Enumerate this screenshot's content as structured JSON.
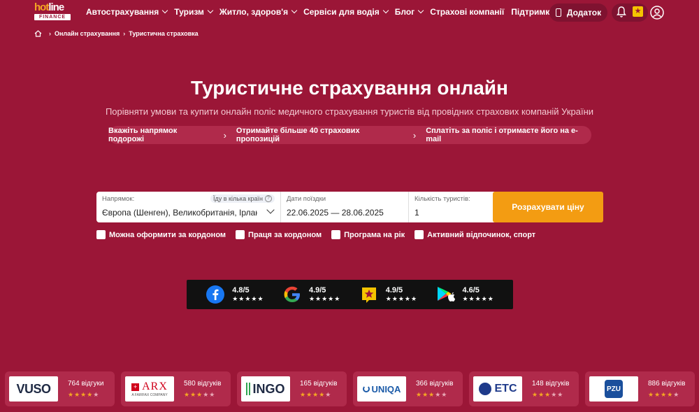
{
  "header": {
    "logo_top": "hotline",
    "logo_hot": "hot",
    "logo_line": "line",
    "logo_bottom": "FINANCE",
    "nav": [
      {
        "label": "Автострахування",
        "dropdown": true
      },
      {
        "label": "Туризм",
        "dropdown": true
      },
      {
        "label": "Житло, здоров'я",
        "dropdown": true
      },
      {
        "label": "Сервіси для водія",
        "dropdown": true
      },
      {
        "label": "Блог",
        "dropdown": true
      },
      {
        "label": "Страхові компанії",
        "dropdown": false
      },
      {
        "label": "Підтримка",
        "dropdown": false
      }
    ],
    "app_button": "Додаток"
  },
  "breadcrumb": [
    "Онлайн страхування",
    "Туристична страховка"
  ],
  "hero": {
    "title": "Туристичне страхування онлайн",
    "subtitle": "Порівняти умови та купити онлайн поліс медичного страхування туристів від провідних страхових компаній України",
    "steps": [
      "Вкажіть напрямок подорожі",
      "Отримайте більше 40 страхових пропозицій",
      "Сплатіть за поліс і отримаєте його на e-mail"
    ]
  },
  "form": {
    "direction_label": "Напрямок:",
    "direction_value": "Європа (Шенген), Великобританія, Ірлан...",
    "multi_tag": "Їду в кілька країн",
    "dates_label": "Дати поїздки",
    "dates_value": "22.06.2025 — 28.06.2025",
    "count_label": "Кількість туристів:",
    "count_value": "1",
    "submit": "Розрахувати ціну"
  },
  "checkboxes": [
    "Можна оформити за кордоном",
    "Праця за кордоном",
    "Програма на рік",
    "Активний відпочинок, спорт"
  ],
  "ratings": [
    {
      "icon": "facebook-icon",
      "score": "4.8/5",
      "stars": "★★★★★"
    },
    {
      "icon": "google-icon",
      "score": "4.9/5",
      "stars": "★★★★★"
    },
    {
      "icon": "hotline-star-icon",
      "score": "4.9/5",
      "stars": "★★★★★"
    },
    {
      "icon": "app-store-icon",
      "score": "4.6/5",
      "stars": "★★★★★"
    }
  ],
  "companies": [
    {
      "name": "VUSO",
      "reviews": "764 відгуки",
      "stars": 4
    },
    {
      "name": "ARX",
      "sub": "A FAIRFAX COMPANY",
      "reviews": "580 відгуків",
      "stars": 3
    },
    {
      "name": "INGO",
      "reviews": "165 відгуків",
      "stars": 4
    },
    {
      "name": "UNIQA",
      "reviews": "366 відгуків",
      "stars": 3
    },
    {
      "name": "ETC",
      "reviews": "148 відгуків",
      "stars": 3
    },
    {
      "name": "PZU",
      "reviews": "886 відгуків",
      "stars": 4
    }
  ],
  "colors": {
    "bg": "#9b1637",
    "accent": "#f39c12",
    "star": "#f5a623"
  }
}
